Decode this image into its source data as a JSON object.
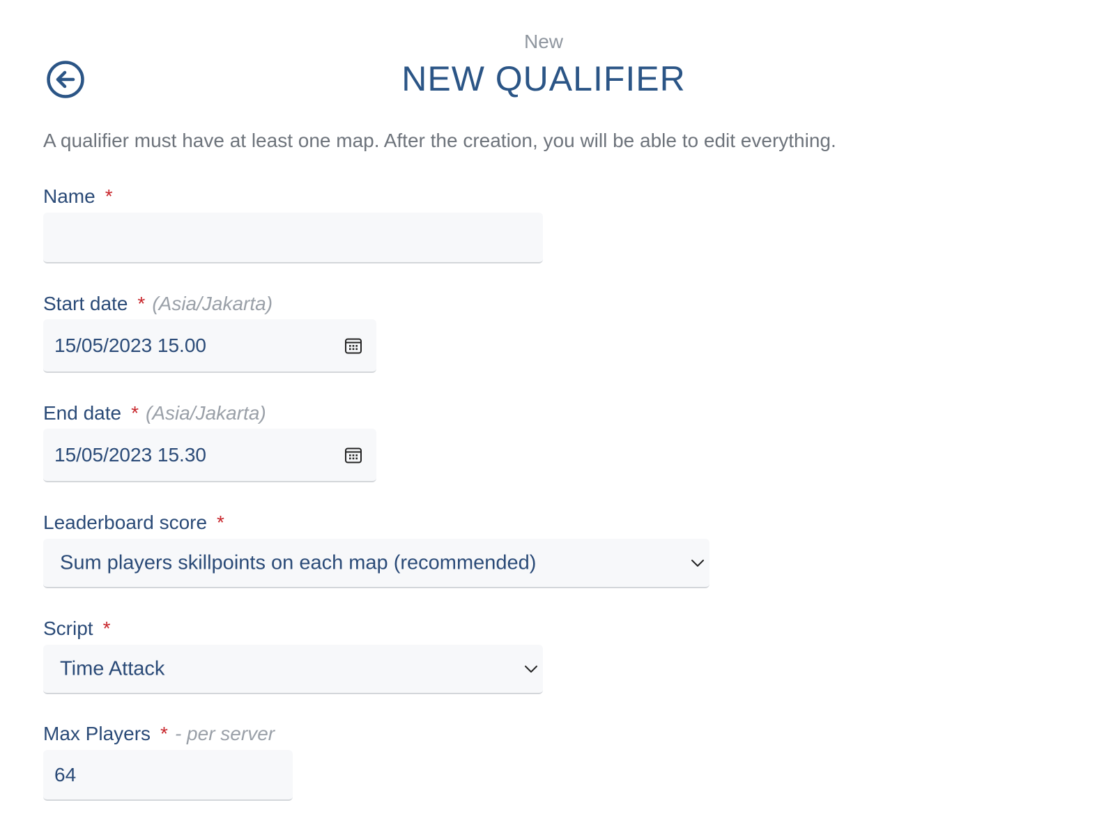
{
  "header": {
    "subtitle": "New",
    "title": "NEW QUALIFIER",
    "back_icon": "arrow-left-circle-icon"
  },
  "intro": "A qualifier must have at least one map. After the creation, you will be able to edit everything.",
  "form": {
    "name": {
      "label": "Name",
      "required_mark": "*",
      "value": ""
    },
    "start_date": {
      "label": "Start date",
      "required_mark": "*",
      "hint": "(Asia/Jakarta)",
      "value": "15/05/2023 15.00",
      "icon": "calendar-icon"
    },
    "end_date": {
      "label": "End date",
      "required_mark": "*",
      "hint": "(Asia/Jakarta)",
      "value": "15/05/2023 15.30",
      "icon": "calendar-icon"
    },
    "leaderboard_score": {
      "label": "Leaderboard score",
      "required_mark": "*",
      "selected": "Sum players skillpoints on each map (recommended)",
      "icon": "chevron-down-icon"
    },
    "script": {
      "label": "Script",
      "required_mark": "*",
      "selected": "Time Attack",
      "icon": "chevron-down-icon"
    },
    "max_players": {
      "label": "Max Players",
      "required_mark": "*",
      "hint": "- per server",
      "value": "64"
    }
  }
}
